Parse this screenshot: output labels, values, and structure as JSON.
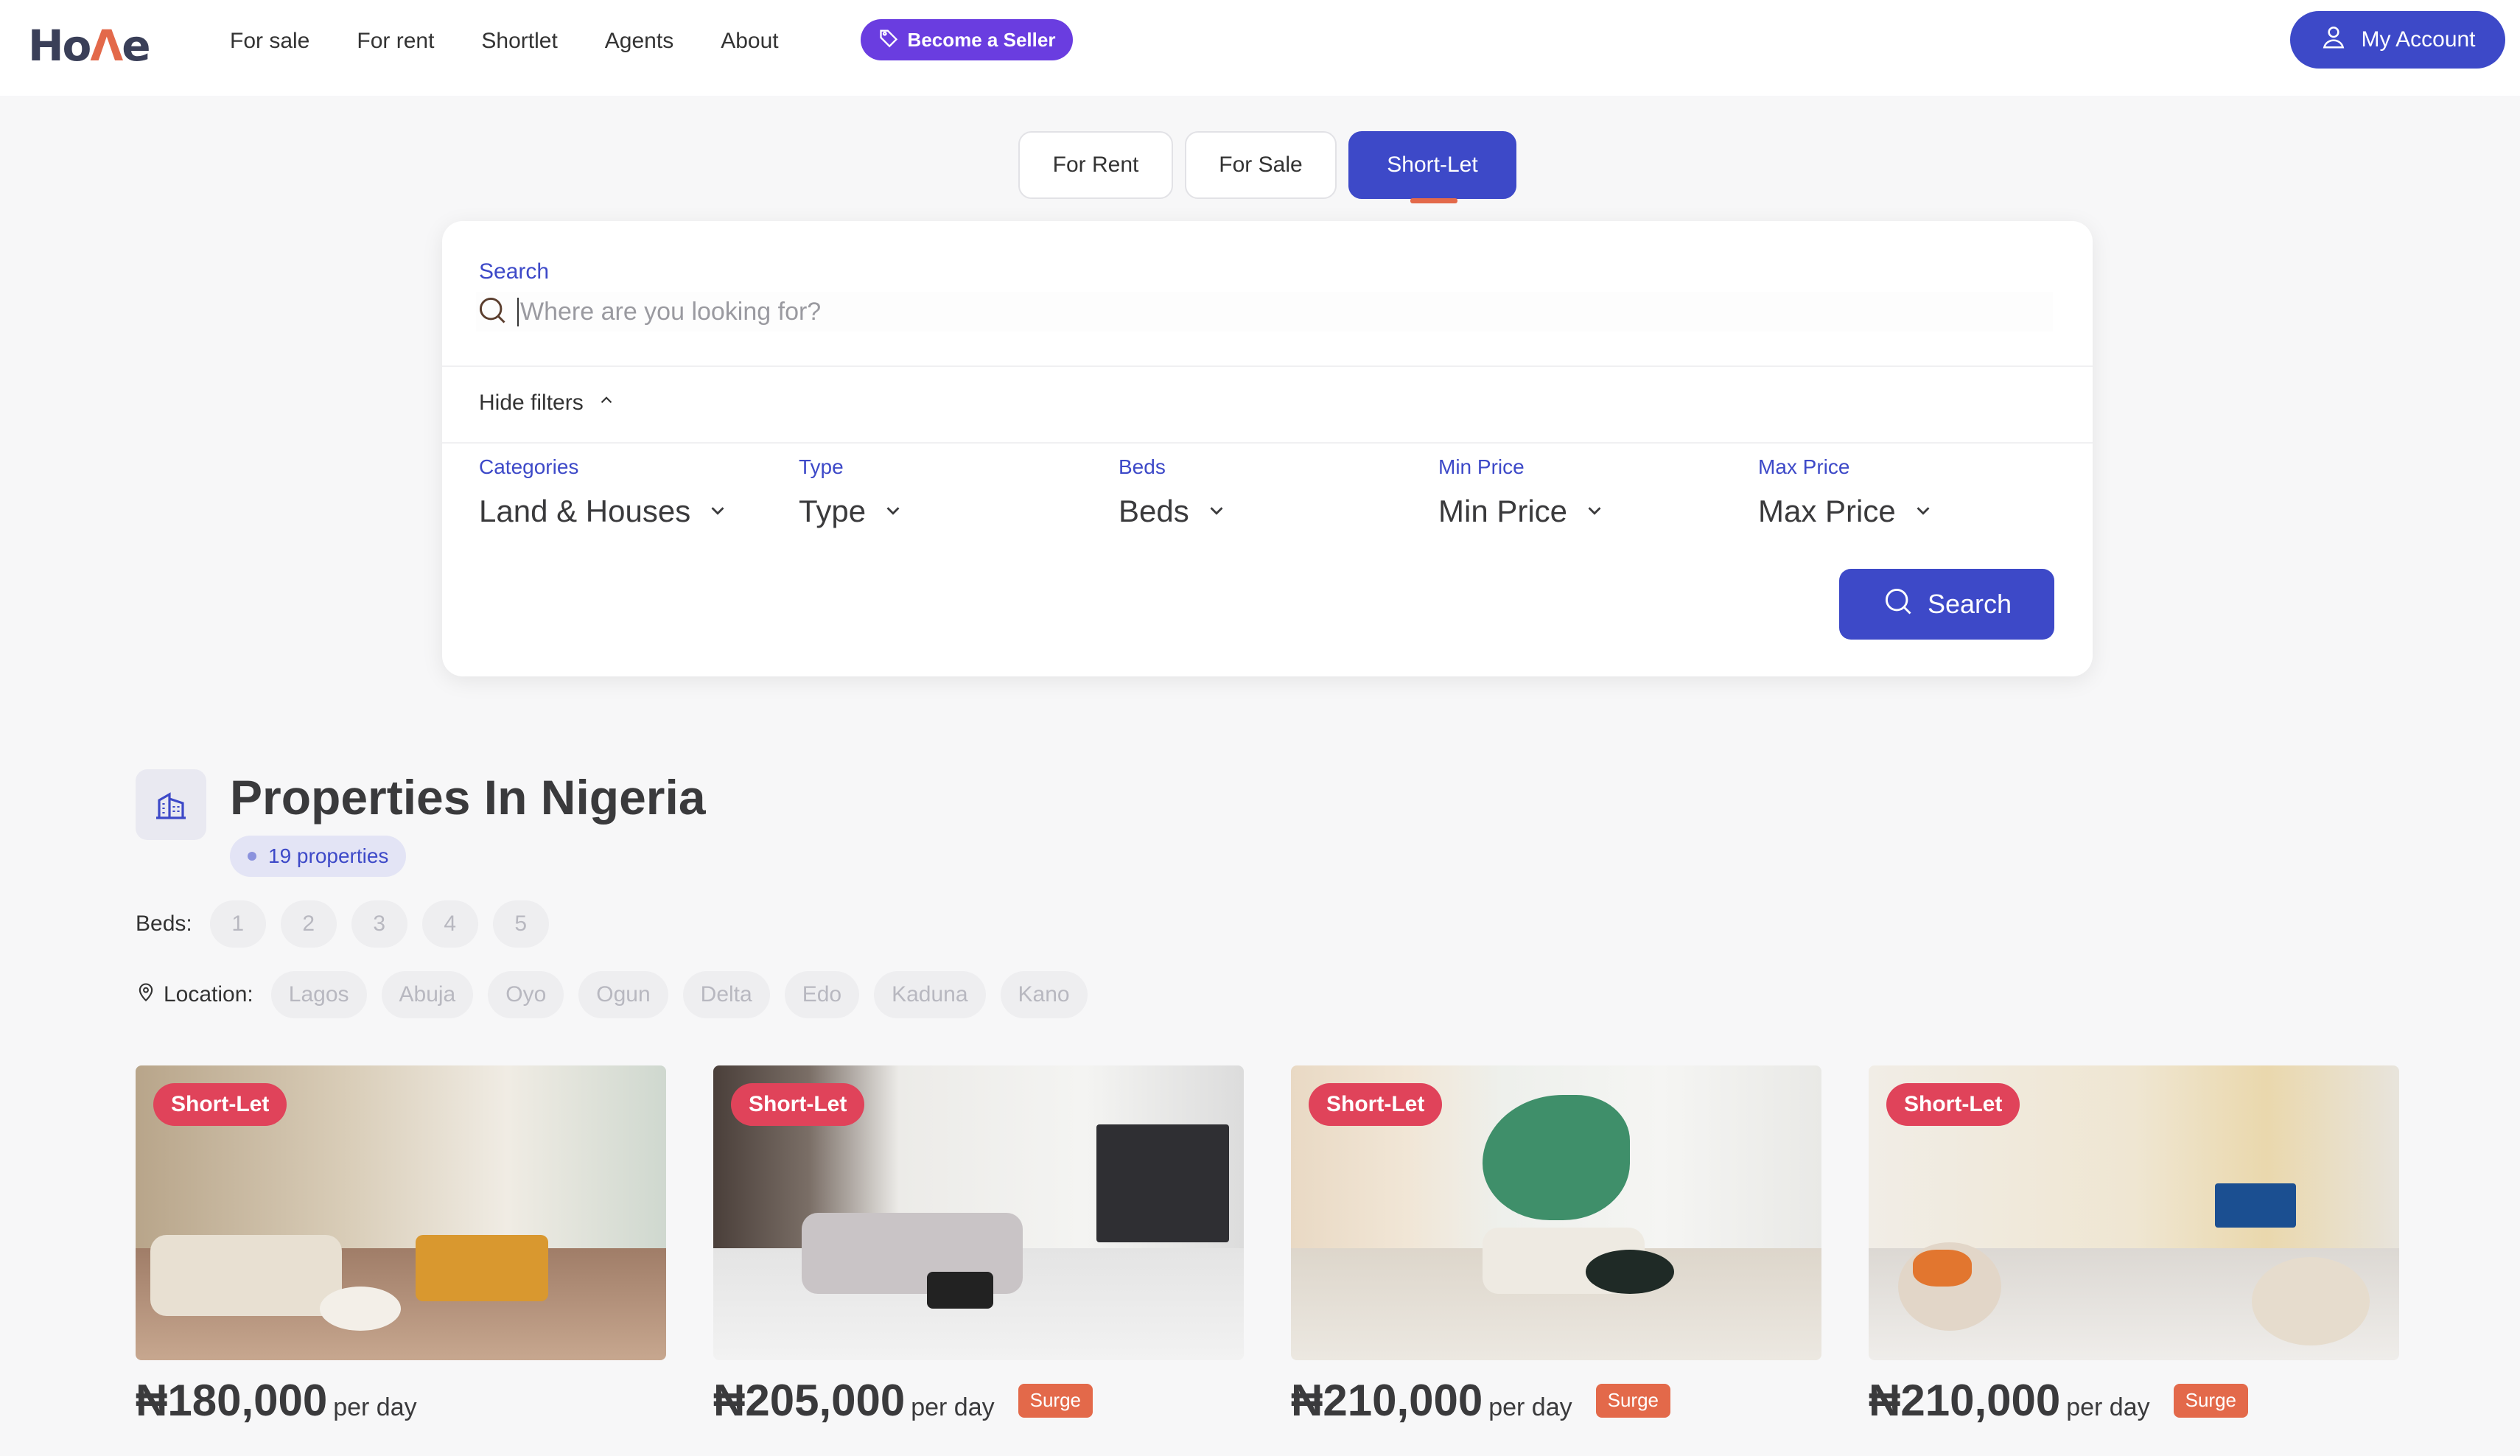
{
  "logo": "Home",
  "nav": [
    "For sale",
    "For rent",
    "Shortlet",
    "Agents",
    "About"
  ],
  "seller_button": "Become a Seller",
  "account_button": "My Account",
  "tabs": [
    {
      "label": "For Rent",
      "active": false
    },
    {
      "label": "For Sale",
      "active": false
    },
    {
      "label": "Short-Let",
      "active": true
    }
  ],
  "search": {
    "label": "Search",
    "placeholder": "Where are you looking for?",
    "hide_filters": "Hide filters",
    "button": "Search"
  },
  "filters": [
    {
      "label": "Categories",
      "value": "Land & Houses"
    },
    {
      "label": "Type",
      "value": "Type"
    },
    {
      "label": "Beds",
      "value": "Beds"
    },
    {
      "label": "Min Price",
      "value": "Min Price"
    },
    {
      "label": "Max Price",
      "value": "Max Price"
    }
  ],
  "section": {
    "title": "Properties In Nigeria",
    "count": "19 properties"
  },
  "beds_filter": {
    "label": "Beds:",
    "options": [
      "1",
      "2",
      "3",
      "4",
      "5"
    ]
  },
  "location_filter": {
    "label": "Location:",
    "options": [
      "Lagos",
      "Abuja",
      "Oyo",
      "Ogun",
      "Delta",
      "Edo",
      "Kaduna",
      "Kano"
    ]
  },
  "listings": [
    {
      "badge": "Short-Let",
      "price": "₦180,000",
      "unit": "per day",
      "surge": ""
    },
    {
      "badge": "Short-Let",
      "price": "₦205,000",
      "unit": "per day",
      "surge": "Surge"
    },
    {
      "badge": "Short-Let",
      "price": "₦210,000",
      "unit": "per day",
      "surge": "Surge"
    },
    {
      "badge": "Short-Let",
      "price": "₦210,000",
      "unit": "per day",
      "surge": "Surge"
    }
  ],
  "colors": {
    "primary": "#3d49c8",
    "seller": "#6a3de0",
    "accent": "#e3694a",
    "badge": "#e0435a"
  }
}
